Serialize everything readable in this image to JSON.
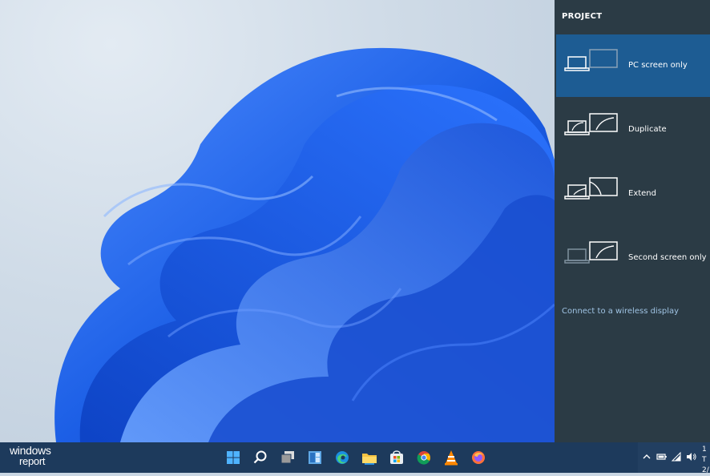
{
  "project_pane": {
    "title": "PROJECT",
    "options": [
      {
        "label": "PC screen only",
        "selected": true,
        "icon": "pc-screen-only-icon"
      },
      {
        "label": "Duplicate",
        "selected": false,
        "icon": "duplicate-icon"
      },
      {
        "label": "Extend",
        "selected": false,
        "icon": "extend-icon"
      },
      {
        "label": "Second screen only",
        "selected": false,
        "icon": "second-screen-only-icon"
      }
    ],
    "connect_link": "Connect to a wireless display"
  },
  "watermark": {
    "line1": "windows",
    "line2": "report"
  },
  "taskbar": {
    "icons": [
      "start-icon",
      "search-icon",
      "task-view-icon",
      "widgets-icon",
      "edge-icon",
      "file-explorer-icon",
      "store-icon",
      "chrome-icon",
      "vlc-icon",
      "firefox-icon"
    ]
  },
  "tray": {
    "icons": [
      "chevron-up-icon",
      "battery-icon",
      "wifi-icon",
      "volume-icon"
    ],
    "clock_line1": "1",
    "clock_line2": "T",
    "clock_line3": "2/"
  },
  "colors": {
    "pane_bg": "#2b3b45",
    "selected_bg": "#1d5c93",
    "link": "#9fc3e3",
    "taskbar": "#1d3a5c",
    "bloom": "#1e63e0"
  }
}
